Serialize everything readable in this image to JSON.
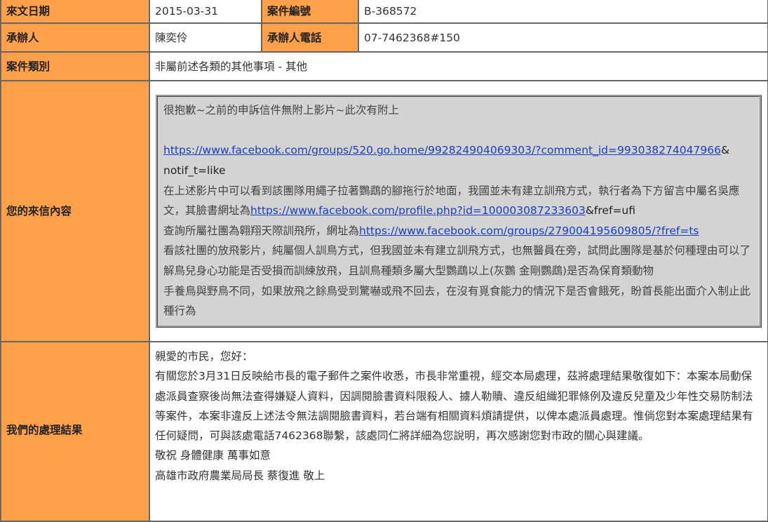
{
  "header": {
    "date_label": "來文日期",
    "date_value": "2015-03-31",
    "case_no_label": "案件編號",
    "case_no_value": "B-368572",
    "handler_label": "承辦人",
    "handler_value": "陳奕伶",
    "handler_phone_label": "承辦人電話",
    "handler_phone_value": "07-7462368#150",
    "category_label": "案件類別",
    "category_value": "非屬前述各類的其他事項 - 其他"
  },
  "letter": {
    "label": "您的來信內容",
    "line1": "很抱歉~之前的申訴信件無附上影片~此次有附上",
    "link1": "https://www.facebook.com/groups/520.go.home/992824904069303/?comment_id=993038274047966",
    "link1_suffix": "&",
    "line2": "notif_t=like",
    "para1": "在上述影片中可以看到該團隊用繩子拉著鸚鵡的腳拖行於地面，我國並未有建立訓飛方式，執行者為下方留言中屬名吳應文，其臉書網址為",
    "link2": "https://www.facebook.com/profile.php?id=100003087233603",
    "link2_suffix": "&fref=ufi",
    "para2": "查詢所屬社團為翱翔天際訓飛所，網址為",
    "link3": "https://www.facebook.com/groups/279004195609805/?fref=ts",
    "para3": "看該社團的放飛影片，純屬個人訓鳥方式，但我國並未有建立訓飛方式，也無醫員在旁，試問此團隊是基於何種理由可以了解鳥兒身心功能是否受損而訓練放飛，且訓鳥種類多屬大型鸚鵡以上(灰鸚 金剛鸚鵡)是否為保育類動物",
    "para4": "手養鳥與野鳥不同，如果放飛之餘鳥受到驚嚇或飛不回去，在沒有覓食能力的情況下是否會餓死，盼首長能出面介入制止此種行為"
  },
  "result": {
    "label": "我們的處理結果",
    "greeting": "親愛的市民，您好：",
    "body": "有關您於3月31日反映給市長的電子郵件之案件收悉，市長非常重視，經交本局處理，茲將處理結果敬復如下：本案本局動保處派員查察後尚無法查得嫌疑人資料，因調閱臉書資料限殺人、擄人勒贖、違反組織犯罪條例及違反兒童及少年性交易防制法等案件，本案非違反上述法令無法調閱臉書資料，若台端有相關資料煩請提供，以俾本處派員處理。惟倘您對本案處理結果有任何疑問，可與該處電話7462368聯繫，該處同仁將詳細為您說明，再次感謝您對市政的關心與建議。",
    "closing": "敬祝 身體健康 萬事如意",
    "signature": "高雄市政府農業局局長 蔡復進 敬上"
  },
  "colors": {
    "label_bg": "#ffa04a",
    "border": "#666666",
    "letter_bg": "#d3d3d3",
    "link": "#1a3fc0"
  }
}
